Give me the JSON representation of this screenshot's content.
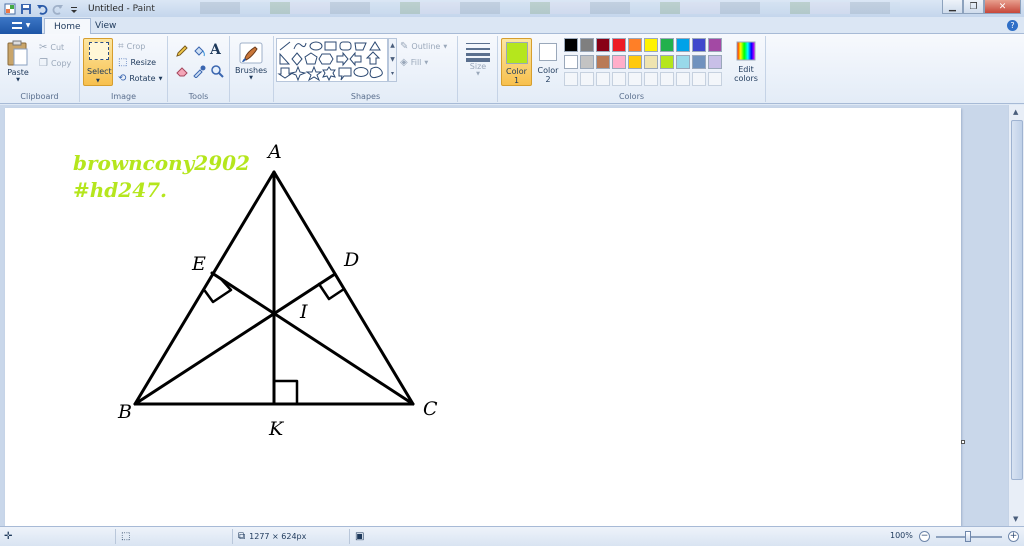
{
  "window": {
    "title": "Untitled",
    "app_name": "Paint",
    "title_sep": " - "
  },
  "tabs": [
    {
      "label": "Home",
      "active": true
    },
    {
      "label": "View",
      "active": false
    }
  ],
  "clipboard": {
    "group_label": "Clipboard",
    "paste": "Paste",
    "cut": "Cut",
    "copy": "Copy"
  },
  "image": {
    "group_label": "Image",
    "select": "Select",
    "crop": "Crop",
    "resize": "Resize",
    "rotate": "Rotate"
  },
  "tools": {
    "group_label": "Tools"
  },
  "brushes": {
    "label": "Brushes"
  },
  "shapes": {
    "group_label": "Shapes",
    "outline": "Outline",
    "fill": "Fill"
  },
  "size": {
    "label": "Size"
  },
  "colors": {
    "group_label": "Colors",
    "color1_label": "Color",
    "color1_num": "1",
    "color2_label": "Color",
    "color2_num": "2",
    "edit_label_1": "Edit",
    "edit_label_2": "colors",
    "color1": "#b5e61d",
    "color2": "#ffffff",
    "palette": [
      "#000000",
      "#7f7f7f",
      "#880015",
      "#ed1c24",
      "#ff7f27",
      "#fff200",
      "#22b14c",
      "#00a2e8",
      "#3f48cc",
      "#a349a4",
      "#ffffff",
      "#c3c3c3",
      "#b97a57",
      "#ffaec9",
      "#ffc90e",
      "#efe4b0",
      "#b5e61d",
      "#99d9ea",
      "#7092be",
      "#c8bfe7"
    ]
  },
  "canvas": {
    "watermark_line1": "browncony2902",
    "watermark_line2": "#hd247.",
    "watermark_color": "#b5e61d",
    "labels": {
      "A": "A",
      "B": "B",
      "C": "C",
      "D": "D",
      "E": "E",
      "I": "I",
      "K": "K"
    }
  },
  "status": {
    "dimensions": "1277 × 624px",
    "zoom": "100%"
  }
}
